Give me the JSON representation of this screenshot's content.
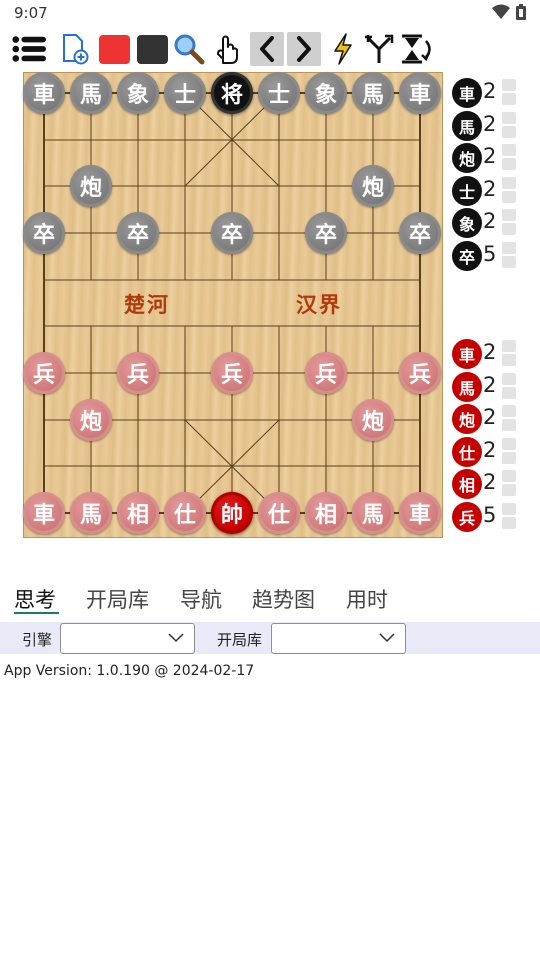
{
  "status_bar": {
    "time": "9:07",
    "icons": [
      "wifi-icon",
      "battery-icon"
    ]
  },
  "toolbar": {
    "buttons": [
      {
        "name": "menu-icon"
      },
      {
        "name": "new-game-icon"
      },
      {
        "name": "red-side-button",
        "color": "#ee3333"
      },
      {
        "name": "black-side-button",
        "color": "#333333"
      },
      {
        "name": "search-icon"
      },
      {
        "name": "hand-icon"
      },
      {
        "name": "prev-move-icon"
      },
      {
        "name": "next-move-icon"
      },
      {
        "name": "lightning-icon"
      },
      {
        "name": "branch-icon"
      },
      {
        "name": "flip-board-icon"
      }
    ]
  },
  "board": {
    "river_left": "楚河",
    "river_right": "汉界",
    "pieces": [
      {
        "char": "車",
        "side": "black",
        "file": 0,
        "rank": 0
      },
      {
        "char": "馬",
        "side": "black",
        "file": 1,
        "rank": 0
      },
      {
        "char": "象",
        "side": "black",
        "file": 2,
        "rank": 0
      },
      {
        "char": "士",
        "side": "black",
        "file": 3,
        "rank": 0
      },
      {
        "char": "将",
        "side": "black",
        "file": 4,
        "rank": 0,
        "king": true
      },
      {
        "char": "士",
        "side": "black",
        "file": 5,
        "rank": 0
      },
      {
        "char": "象",
        "side": "black",
        "file": 6,
        "rank": 0
      },
      {
        "char": "馬",
        "side": "black",
        "file": 7,
        "rank": 0
      },
      {
        "char": "車",
        "side": "black",
        "file": 8,
        "rank": 0
      },
      {
        "char": "炮",
        "side": "black",
        "file": 1,
        "rank": 2
      },
      {
        "char": "炮",
        "side": "black",
        "file": 7,
        "rank": 2
      },
      {
        "char": "卒",
        "side": "black",
        "file": 0,
        "rank": 3
      },
      {
        "char": "卒",
        "side": "black",
        "file": 2,
        "rank": 3
      },
      {
        "char": "卒",
        "side": "black",
        "file": 4,
        "rank": 3
      },
      {
        "char": "卒",
        "side": "black",
        "file": 6,
        "rank": 3
      },
      {
        "char": "卒",
        "side": "black",
        "file": 8,
        "rank": 3
      },
      {
        "char": "兵",
        "side": "red",
        "file": 0,
        "rank": 6
      },
      {
        "char": "兵",
        "side": "red",
        "file": 2,
        "rank": 6
      },
      {
        "char": "兵",
        "side": "red",
        "file": 4,
        "rank": 6
      },
      {
        "char": "兵",
        "side": "red",
        "file": 6,
        "rank": 6
      },
      {
        "char": "兵",
        "side": "red",
        "file": 8,
        "rank": 6
      },
      {
        "char": "炮",
        "side": "red",
        "file": 1,
        "rank": 7
      },
      {
        "char": "炮",
        "side": "red",
        "file": 7,
        "rank": 7
      },
      {
        "char": "車",
        "side": "red",
        "file": 0,
        "rank": 9
      },
      {
        "char": "馬",
        "side": "red",
        "file": 1,
        "rank": 9
      },
      {
        "char": "相",
        "side": "red",
        "file": 2,
        "rank": 9
      },
      {
        "char": "仕",
        "side": "red",
        "file": 3,
        "rank": 9
      },
      {
        "char": "帥",
        "side": "red",
        "file": 4,
        "rank": 9,
        "king": true
      },
      {
        "char": "仕",
        "side": "red",
        "file": 5,
        "rank": 9
      },
      {
        "char": "相",
        "side": "red",
        "file": 6,
        "rank": 9
      },
      {
        "char": "馬",
        "side": "red",
        "file": 7,
        "rank": 9
      },
      {
        "char": "車",
        "side": "red",
        "file": 8,
        "rank": 9
      }
    ]
  },
  "captured": {
    "black": [
      {
        "char": "車",
        "count": "2"
      },
      {
        "char": "馬",
        "count": "2"
      },
      {
        "char": "炮",
        "count": "2"
      },
      {
        "char": "士",
        "count": "2"
      },
      {
        "char": "象",
        "count": "2"
      },
      {
        "char": "卒",
        "count": "5"
      }
    ],
    "red": [
      {
        "char": "車",
        "count": "2"
      },
      {
        "char": "馬",
        "count": "2"
      },
      {
        "char": "炮",
        "count": "2"
      },
      {
        "char": "仕",
        "count": "2"
      },
      {
        "char": "相",
        "count": "2"
      },
      {
        "char": "兵",
        "count": "5"
      }
    ]
  },
  "tabs": [
    {
      "label": "思考",
      "active": true
    },
    {
      "label": "开局库"
    },
    {
      "label": "导航"
    },
    {
      "label": "趋势图"
    },
    {
      "label": "用时"
    }
  ],
  "engine_bar": {
    "engine_label": "引擎",
    "engine_value": "",
    "book_label": "开局库",
    "book_value": ""
  },
  "app_version": "App Version: 1.0.190 @ 2024-02-17"
}
